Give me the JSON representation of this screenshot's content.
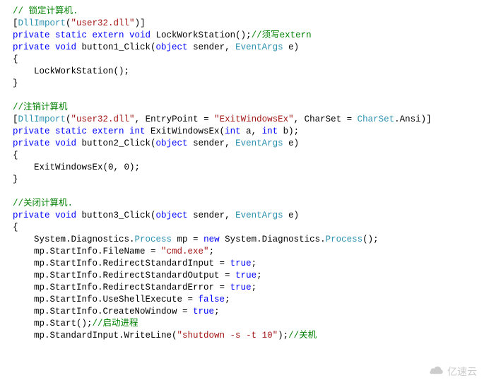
{
  "lines": [
    {
      "segments": [
        {
          "cls": "c-comment",
          "text": "// 锁定计算机."
        }
      ]
    },
    {
      "segments": [
        {
          "cls": "c-black",
          "text": "["
        },
        {
          "cls": "c-type",
          "text": "DllImport"
        },
        {
          "cls": "c-black",
          "text": "("
        },
        {
          "cls": "c-string",
          "text": "\"user32.dll\""
        },
        {
          "cls": "c-black",
          "text": ")]"
        }
      ]
    },
    {
      "segments": [
        {
          "cls": "c-keyword",
          "text": "private static extern void"
        },
        {
          "cls": "c-black",
          "text": " LockWorkStation();"
        },
        {
          "cls": "c-comment",
          "text": "//须写extern"
        }
      ]
    },
    {
      "segments": [
        {
          "cls": "c-keyword",
          "text": "private void"
        },
        {
          "cls": "c-black",
          "text": " button1_Click("
        },
        {
          "cls": "c-keyword",
          "text": "object"
        },
        {
          "cls": "c-black",
          "text": " sender, "
        },
        {
          "cls": "c-type",
          "text": "EventArgs"
        },
        {
          "cls": "c-black",
          "text": " e)"
        }
      ]
    },
    {
      "segments": [
        {
          "cls": "c-black",
          "text": "{"
        }
      ]
    },
    {
      "segments": [
        {
          "cls": "c-black",
          "text": "    LockWorkStation();"
        }
      ]
    },
    {
      "segments": [
        {
          "cls": "c-black",
          "text": "}"
        }
      ]
    },
    {
      "segments": [
        {
          "cls": "c-black",
          "text": ""
        }
      ]
    },
    {
      "segments": [
        {
          "cls": "c-comment",
          "text": "//注销计算机"
        }
      ]
    },
    {
      "segments": [
        {
          "cls": "c-black",
          "text": "["
        },
        {
          "cls": "c-type",
          "text": "DllImport"
        },
        {
          "cls": "c-black",
          "text": "("
        },
        {
          "cls": "c-string",
          "text": "\"user32.dll\""
        },
        {
          "cls": "c-black",
          "text": ", EntryPoint = "
        },
        {
          "cls": "c-string",
          "text": "\"ExitWindowsEx\""
        },
        {
          "cls": "c-black",
          "text": ", CharSet = "
        },
        {
          "cls": "c-type",
          "text": "CharSet"
        },
        {
          "cls": "c-black",
          "text": ".Ansi)]"
        }
      ]
    },
    {
      "segments": [
        {
          "cls": "c-keyword",
          "text": "private static extern int"
        },
        {
          "cls": "c-black",
          "text": " ExitWindowsEx("
        },
        {
          "cls": "c-keyword",
          "text": "int"
        },
        {
          "cls": "c-black",
          "text": " a, "
        },
        {
          "cls": "c-keyword",
          "text": "int"
        },
        {
          "cls": "c-black",
          "text": " b);"
        }
      ]
    },
    {
      "segments": [
        {
          "cls": "c-keyword",
          "text": "private void"
        },
        {
          "cls": "c-black",
          "text": " button2_Click("
        },
        {
          "cls": "c-keyword",
          "text": "object"
        },
        {
          "cls": "c-black",
          "text": " sender, "
        },
        {
          "cls": "c-type",
          "text": "EventArgs"
        },
        {
          "cls": "c-black",
          "text": " e)"
        }
      ]
    },
    {
      "segments": [
        {
          "cls": "c-black",
          "text": "{"
        }
      ]
    },
    {
      "segments": [
        {
          "cls": "c-black",
          "text": "    ExitWindowsEx(0, 0);"
        }
      ]
    },
    {
      "segments": [
        {
          "cls": "c-black",
          "text": "}"
        }
      ]
    },
    {
      "segments": [
        {
          "cls": "c-black",
          "text": ""
        }
      ]
    },
    {
      "segments": [
        {
          "cls": "c-comment",
          "text": "//关闭计算机."
        }
      ]
    },
    {
      "segments": [
        {
          "cls": "c-keyword",
          "text": "private void"
        },
        {
          "cls": "c-black",
          "text": " button3_Click("
        },
        {
          "cls": "c-keyword",
          "text": "object"
        },
        {
          "cls": "c-black",
          "text": " sender, "
        },
        {
          "cls": "c-type",
          "text": "EventArgs"
        },
        {
          "cls": "c-black",
          "text": " e)"
        }
      ]
    },
    {
      "segments": [
        {
          "cls": "c-black",
          "text": "{"
        }
      ]
    },
    {
      "segments": [
        {
          "cls": "c-black",
          "text": "    System.Diagnostics."
        },
        {
          "cls": "c-type",
          "text": "Process"
        },
        {
          "cls": "c-black",
          "text": " mp = "
        },
        {
          "cls": "c-keyword",
          "text": "new"
        },
        {
          "cls": "c-black",
          "text": " System.Diagnostics."
        },
        {
          "cls": "c-type",
          "text": "Process"
        },
        {
          "cls": "c-black",
          "text": "();"
        }
      ]
    },
    {
      "segments": [
        {
          "cls": "c-black",
          "text": "    mp.StartInfo.FileName = "
        },
        {
          "cls": "c-string",
          "text": "\"cmd.exe\""
        },
        {
          "cls": "c-black",
          "text": ";"
        }
      ]
    },
    {
      "segments": [
        {
          "cls": "c-black",
          "text": "    mp.StartInfo.RedirectStandardInput = "
        },
        {
          "cls": "c-keyword",
          "text": "true"
        },
        {
          "cls": "c-black",
          "text": ";"
        }
      ]
    },
    {
      "segments": [
        {
          "cls": "c-black",
          "text": "    mp.StartInfo.RedirectStandardOutput = "
        },
        {
          "cls": "c-keyword",
          "text": "true"
        },
        {
          "cls": "c-black",
          "text": ";"
        }
      ]
    },
    {
      "segments": [
        {
          "cls": "c-black",
          "text": "    mp.StartInfo.RedirectStandardError = "
        },
        {
          "cls": "c-keyword",
          "text": "true"
        },
        {
          "cls": "c-black",
          "text": ";"
        }
      ]
    },
    {
      "segments": [
        {
          "cls": "c-black",
          "text": "    mp.StartInfo.UseShellExecute = "
        },
        {
          "cls": "c-keyword",
          "text": "false"
        },
        {
          "cls": "c-black",
          "text": ";"
        }
      ]
    },
    {
      "segments": [
        {
          "cls": "c-black",
          "text": "    mp.StartInfo.CreateNoWindow = "
        },
        {
          "cls": "c-keyword",
          "text": "true"
        },
        {
          "cls": "c-black",
          "text": ";"
        }
      ]
    },
    {
      "segments": [
        {
          "cls": "c-black",
          "text": "    mp.Start();"
        },
        {
          "cls": "c-comment",
          "text": "//启动进程"
        }
      ]
    },
    {
      "segments": [
        {
          "cls": "c-black",
          "text": "    mp.StandardInput.WriteLine("
        },
        {
          "cls": "c-string",
          "text": "\"shutdown -s -t 10\""
        },
        {
          "cls": "c-black",
          "text": ");"
        },
        {
          "cls": "c-comment",
          "text": "//关机"
        }
      ]
    }
  ],
  "watermark": "亿速云"
}
